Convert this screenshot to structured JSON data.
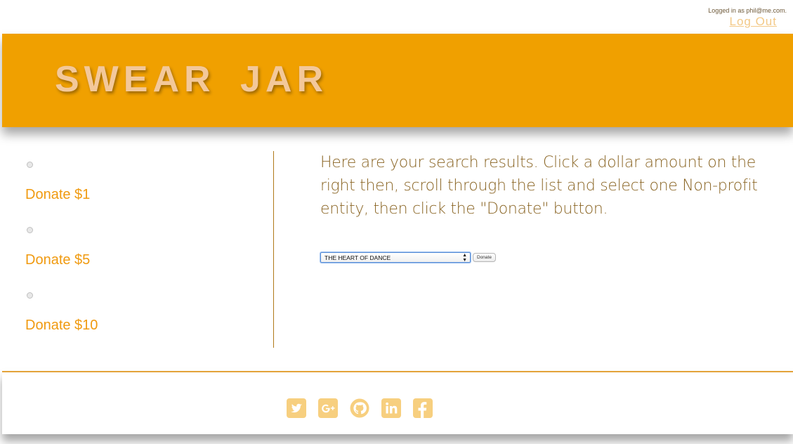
{
  "session": {
    "logged_in_text": "Logged in as phil@me.com.",
    "logout_label": "Log Out"
  },
  "header": {
    "brand": "SWEAR JAR",
    "background_color": "#f0a000",
    "brand_color": "#f3c89a"
  },
  "donate_options": [
    {
      "label": "Donate $1",
      "selected": false
    },
    {
      "label": "Donate $5",
      "selected": false
    },
    {
      "label": "Donate $10",
      "selected": false
    }
  ],
  "main": {
    "instructions": "Here are your search results. Click a dollar amount on the right then, scroll through the list and select one Non-profit entity, then click the \"Donate\" button.",
    "nonprofit_select": {
      "selected_value": "THE HEART OF DANCE"
    },
    "donate_button_label": "Donate"
  },
  "footer": {
    "social_icons": [
      "twitter-icon",
      "google-plus-icon",
      "github-icon",
      "linkedin-icon",
      "facebook-icon"
    ],
    "icon_color": "#f7cf7f"
  }
}
